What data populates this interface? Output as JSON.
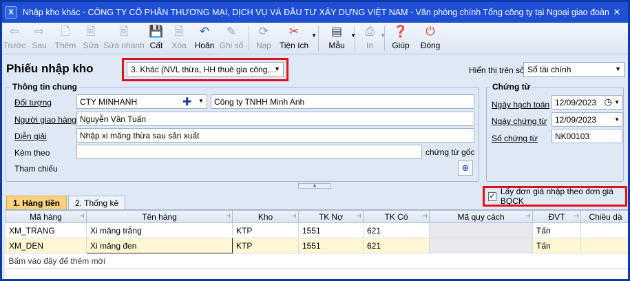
{
  "window": {
    "title": "Nhập kho khác - CÔNG TY CỔ PHẦN THƯƠNG MẠI, DỊCH VỤ VÀ ĐẦU TƯ XÂY DỰNG VIỆT NAM - Văn phòng chính Tổng công ty tại Ngoại giao đoàn, quận...",
    "app_icon": "X"
  },
  "toolbar": {
    "items": [
      {
        "label": "Trước",
        "icon": "arrow-left-icon",
        "enabled": false
      },
      {
        "label": "Sau",
        "icon": "arrow-right-icon",
        "enabled": false
      },
      {
        "label": "Thêm",
        "icon": "add-document-icon",
        "enabled": false
      },
      {
        "label": "Sửa",
        "icon": "edit-document-icon",
        "enabled": false
      },
      {
        "label": "Sửa nhanh",
        "icon": "quick-edit-icon",
        "enabled": false
      },
      {
        "label": "Cất",
        "icon": "save-icon",
        "enabled": true
      },
      {
        "label": "Xóa",
        "icon": "delete-document-icon",
        "enabled": false
      },
      {
        "label": "Hoãn",
        "icon": "undo-icon",
        "enabled": true
      },
      {
        "label": "Ghi sổ",
        "icon": "pen-icon",
        "enabled": false
      },
      {
        "label": "Nạp",
        "icon": "refresh-icon",
        "enabled": false
      },
      {
        "label": "Tiện ích",
        "icon": "tools-icon",
        "enabled": true
      },
      {
        "label": "Mẫu",
        "icon": "template-icon",
        "enabled": true
      },
      {
        "label": "In",
        "icon": "printer-icon",
        "enabled": false
      },
      {
        "label": "Giúp",
        "icon": "help-icon",
        "enabled": true
      },
      {
        "label": "Đóng",
        "icon": "close-power-icon",
        "enabled": true
      }
    ]
  },
  "form": {
    "heading": "Phiếu nhập kho",
    "type_select": "3. Khác (NVL thừa, HH thuê gia công,...",
    "display_label": "Hiển thị trên sổ",
    "display_select": "Sổ tài chính",
    "general_group": "Thông tin chung",
    "doi_tuong_label": "Đối tượng",
    "doi_tuong_code": "CTY MINHANH",
    "doi_tuong_name": "Công ty TNHH Minh Anh",
    "nguoi_giao_label": "Người giao hàng",
    "nguoi_giao_value": "Nguyễn Văn Tuấn",
    "dien_giai_label": "Diễn giải",
    "dien_giai_value": "Nhập xi măng thừa sau sản xuất",
    "kem_theo_label": "Kèm theo",
    "kem_theo_value": "",
    "chung_tu_goc": "chứng từ gốc",
    "tham_chieu_label": "Tham chiếu",
    "voucher_group": "Chứng từ",
    "ngay_hach_toan_label": "Ngày hạch toán",
    "ngay_hach_toan": "12/09/2023",
    "ngay_chung_tu_label": "Ngày chứng từ",
    "ngay_chung_tu": "12/09/2023",
    "so_chung_tu_label": "Số chứng từ",
    "so_chung_tu": "NK00103"
  },
  "tabs": [
    "1. Hàng tiền",
    "2. Thống kê"
  ],
  "checkbox": {
    "label": "Lấy đơn giá nhập theo đơn giá BQCK",
    "checked": true
  },
  "grid": {
    "columns": [
      "Mã hàng",
      "Tên hàng",
      "Kho",
      "TK Nợ",
      "TK Có",
      "Mã quy cách",
      "ĐVT",
      "Chiều dà"
    ],
    "rows": [
      [
        "XM_TRANG",
        "Xi măng trắng",
        "KTP",
        "1551",
        "621",
        "",
        "Tấn",
        ""
      ],
      [
        "XM_DEN",
        "Xi măng đen",
        "KTP",
        "1551",
        "621",
        "",
        "Tấn",
        ""
      ]
    ],
    "add_row_text": "Bấm vào đây để thêm mới"
  }
}
